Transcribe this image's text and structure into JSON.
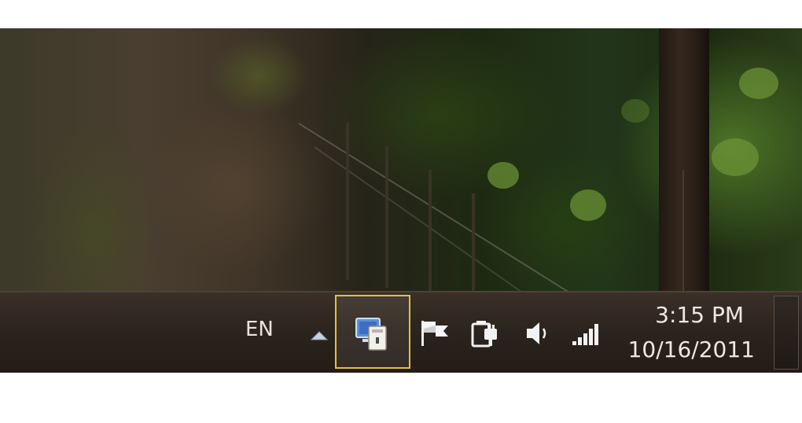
{
  "taskbar": {
    "language": "EN",
    "overflow_icon": "chevron-up-icon",
    "highlighted_icon": "network-connections-icon",
    "highlight_color": "#e2c23a",
    "tray_icons": [
      {
        "icon": "action-center-flag-icon"
      },
      {
        "icon": "power-plug-icon"
      },
      {
        "icon": "speaker-volume-icon"
      },
      {
        "icon": "signal-strength-icon"
      }
    ],
    "clock": {
      "time": "3:15 PM",
      "date": "10/16/2011"
    },
    "show_desktop": "show-desktop-button"
  }
}
